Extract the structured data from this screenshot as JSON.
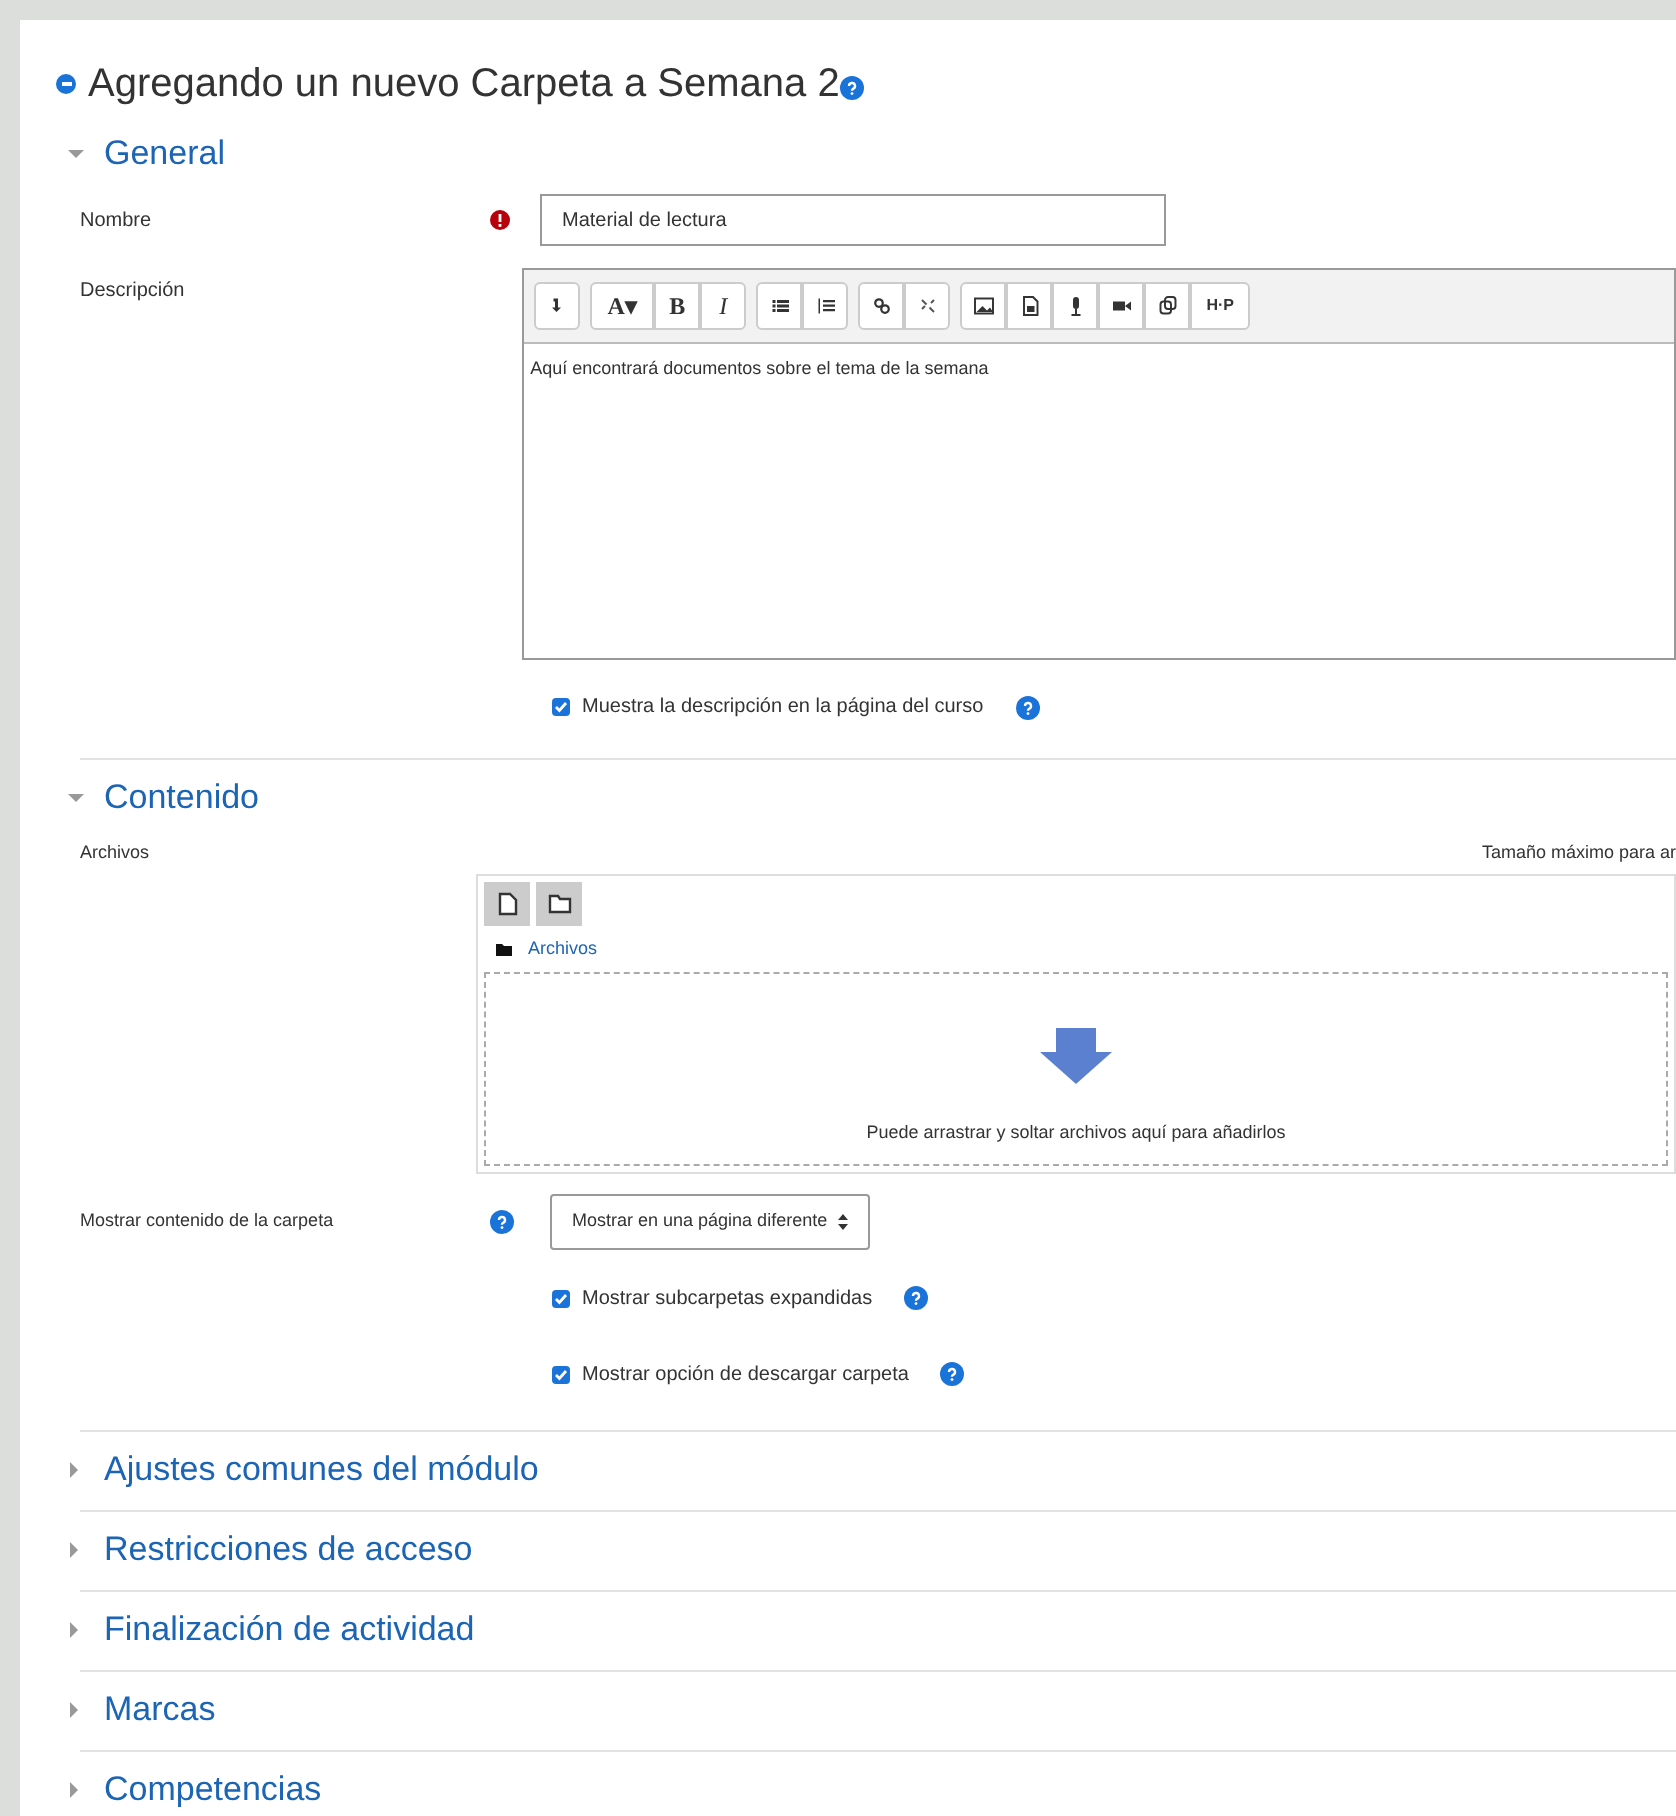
{
  "title": "Agregando un nuevo Carpeta a Semana 2",
  "sections": [
    {
      "kind": "general",
      "heading": "General",
      "expanded": true,
      "name_label": "Nombre",
      "name_value": "Material de lectura",
      "description_label": "Descripción",
      "toolbar": [
        [
          {
            "kind": "icon"
          }
        ],
        [
          {
            "kind": "text",
            "label": "A▾"
          },
          {
            "kind": "text",
            "label": "B"
          },
          {
            "kind": "italic",
            "label": "I"
          }
        ],
        [
          {
            "kind": "icon"
          },
          {
            "kind": "icon"
          }
        ],
        [
          {
            "kind": "icon"
          },
          {
            "kind": "icon"
          }
        ],
        [
          {
            "kind": "icon"
          },
          {
            "kind": "icon"
          },
          {
            "kind": "icon"
          },
          {
            "kind": "icon"
          },
          {
            "kind": "icon"
          },
          {
            "kind": "logo",
            "label": "H·P"
          }
        ]
      ],
      "description_text": "Aquí encontrará documentos sobre el tema de la semana",
      "checkboxes": [
        {
          "label": "Muestra la descripción en la página del curso",
          "checked": true
        }
      ]
    },
    {
      "kind": "content",
      "heading": "Contenido",
      "expanded": true,
      "files_label": "Archivos",
      "max_size": "Tamaño máximo para ar",
      "path": "Archivos",
      "drop_hint": "Puede arrastrar y soltar archivos aquí para añadirlos",
      "display_label": "Mostrar contenido de la carpeta",
      "display_value": "Mostrar en una página diferente",
      "checkboxes": [
        {
          "label": "Mostrar subcarpetas expandidas",
          "checked": true
        },
        {
          "label": "Mostrar opción de descargar carpeta",
          "checked": true
        }
      ]
    },
    {
      "kind": "collapsed",
      "heading": "Ajustes comunes del módulo",
      "expanded": false
    },
    {
      "kind": "collapsed",
      "heading": "Restricciones de acceso",
      "expanded": false
    },
    {
      "kind": "collapsed",
      "heading": "Finalización de actividad",
      "expanded": false
    },
    {
      "kind": "collapsed",
      "heading": "Marcas",
      "expanded": false
    },
    {
      "kind": "collapsed",
      "heading": "Competencias",
      "expanded": false
    }
  ]
}
